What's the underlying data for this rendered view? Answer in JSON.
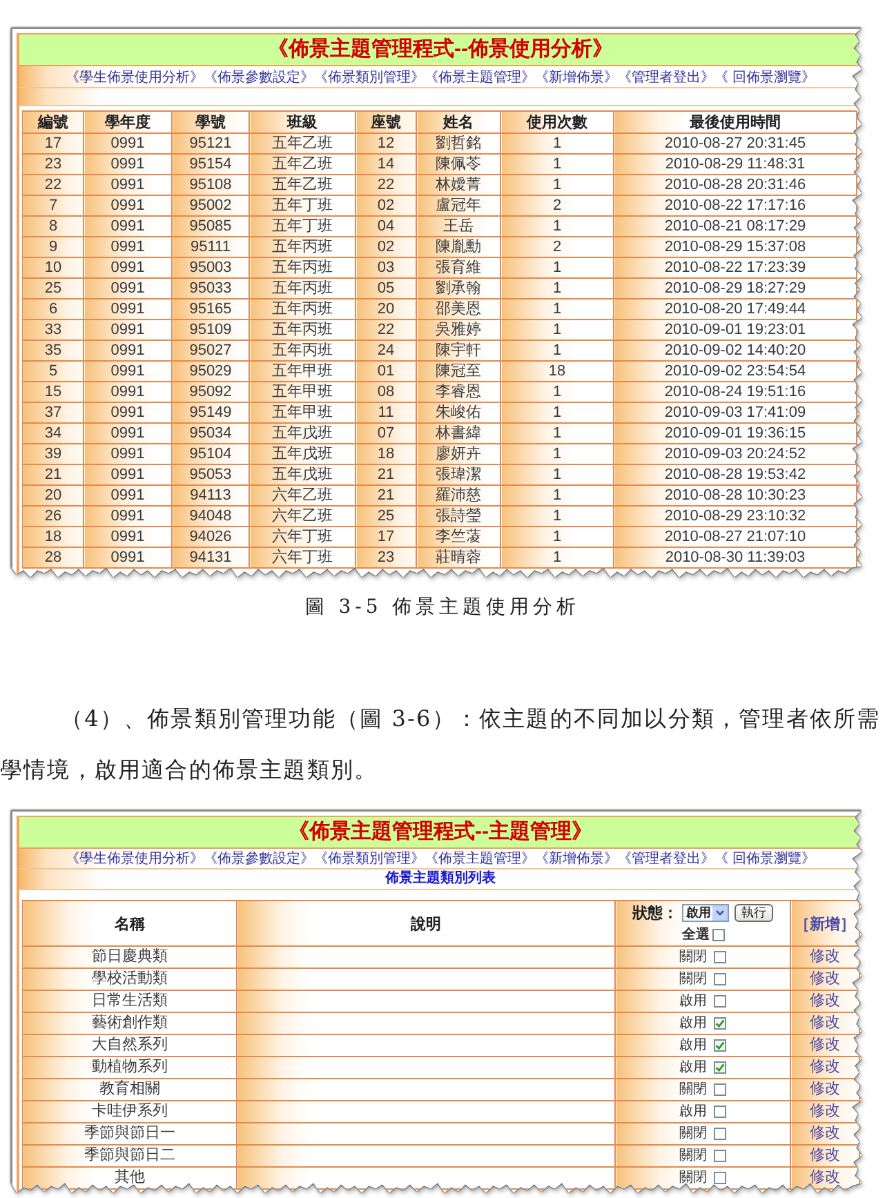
{
  "usage_screenshot": {
    "title": "《佈景主題管理程式--佈景使用分析》",
    "nav_links": [
      "《學生佈景使用分析》",
      "《佈景參數設定》",
      "《佈景類別管理》",
      "《佈景主題管理》",
      "《新增佈景》",
      "《管理者登出》",
      "《 回佈景瀏覽》"
    ],
    "table": {
      "columns": [
        "編號",
        "學年度",
        "學號",
        "班級",
        "座號",
        "姓名",
        "使用次數",
        "最後使用時間"
      ],
      "rows": [
        [
          "17",
          "0991",
          "95121",
          "五年乙班",
          "12",
          "劉哲銘",
          "1",
          "2010-08-27 20:31:45"
        ],
        [
          "23",
          "0991",
          "95154",
          "五年乙班",
          "14",
          "陳佩苓",
          "1",
          "2010-08-29 11:48:31"
        ],
        [
          "22",
          "0991",
          "95108",
          "五年乙班",
          "22",
          "林嬡菁",
          "1",
          "2010-08-28 20:31:46"
        ],
        [
          "7",
          "0991",
          "95002",
          "五年丁班",
          "02",
          "盧冠年",
          "2",
          "2010-08-22 17:17:16"
        ],
        [
          "8",
          "0991",
          "95085",
          "五年丁班",
          "04",
          "王岳",
          "1",
          "2010-08-21 08:17:29"
        ],
        [
          "9",
          "0991",
          "95111",
          "五年丙班",
          "02",
          "陳胤勳",
          "2",
          "2010-08-29 15:37:08"
        ],
        [
          "10",
          "0991",
          "95003",
          "五年丙班",
          "03",
          "張育維",
          "1",
          "2010-08-22 17:23:39"
        ],
        [
          "25",
          "0991",
          "95033",
          "五年丙班",
          "05",
          "劉承翰",
          "1",
          "2010-08-29 18:27:29"
        ],
        [
          "6",
          "0991",
          "95165",
          "五年丙班",
          "20",
          "邵美恩",
          "1",
          "2010-08-20 17:49:44"
        ],
        [
          "33",
          "0991",
          "95109",
          "五年丙班",
          "22",
          "吳雅婷",
          "1",
          "2010-09-01 19:23:01"
        ],
        [
          "35",
          "0991",
          "95027",
          "五年丙班",
          "24",
          "陳宇軒",
          "1",
          "2010-09-02 14:40:20"
        ],
        [
          "5",
          "0991",
          "95029",
          "五年甲班",
          "01",
          "陳冠至",
          "18",
          "2010-09-02 23:54:54"
        ],
        [
          "15",
          "0991",
          "95092",
          "五年甲班",
          "08",
          "李睿恩",
          "1",
          "2010-08-24 19:51:16"
        ],
        [
          "37",
          "0991",
          "95149",
          "五年甲班",
          "11",
          "朱峻佑",
          "1",
          "2010-09-03 17:41:09"
        ],
        [
          "34",
          "0991",
          "95034",
          "五年戊班",
          "07",
          "林書緯",
          "1",
          "2010-09-01 19:36:15"
        ],
        [
          "39",
          "0991",
          "95104",
          "五年戊班",
          "18",
          "廖妍卉",
          "1",
          "2010-09-03 20:24:52"
        ],
        [
          "21",
          "0991",
          "95053",
          "五年戊班",
          "21",
          "張瑋潔",
          "1",
          "2010-08-28 19:53:42"
        ],
        [
          "20",
          "0991",
          "94113",
          "六年乙班",
          "21",
          "羅沛慈",
          "1",
          "2010-08-28 10:30:23"
        ],
        [
          "26",
          "0991",
          "94048",
          "六年乙班",
          "25",
          "張詩瑩",
          "1",
          "2010-08-29 23:10:32"
        ],
        [
          "18",
          "0991",
          "94026",
          "六年丁班",
          "17",
          "李竺蓤",
          "1",
          "2010-08-27 21:07:10"
        ],
        [
          "28",
          "0991",
          "94131",
          "六年丁班",
          "23",
          "莊晴蓉",
          "1",
          "2010-08-30 11:39:03"
        ]
      ]
    }
  },
  "figure_caption": "圖 3-5 佈景主題使用分析",
  "paragraph": {
    "lines": [
      "（4）、佈景類別管理功能（圖 3-6）：依主題的不同加以分類，管理者依所需",
      "學情境，啟用適合的佈景主題類別。"
    ]
  },
  "category_screenshot": {
    "title": "《佈景主題管理程式--主題管理》",
    "nav_links": [
      "《學生佈景使用分析》",
      "《佈景參數設定》",
      "《佈景類別管理》",
      "《佈景主題管理》",
      "《新增佈景》",
      "《管理者登出》",
      "《 回佈景瀏覽》"
    ],
    "list_title": "佈景主題類別列表",
    "columns": [
      "名稱",
      "說明"
    ],
    "status_header": {
      "label": "狀態：",
      "filter_value": "啟用",
      "run_button": "執行",
      "select_all_label": "全選",
      "select_all_checked": false
    },
    "add_link": "［新增］",
    "rows": [
      {
        "name": "節日慶典類",
        "status": "關閉",
        "checked": false,
        "edit_link": "修改"
      },
      {
        "name": "學校活動類",
        "status": "關閉",
        "checked": false,
        "edit_link": "修改"
      },
      {
        "name": "日常生活類",
        "status": "啟用",
        "checked": false,
        "edit_link": "修改"
      },
      {
        "name": "藝術創作類",
        "status": "啟用",
        "checked": true,
        "edit_link": "修改"
      },
      {
        "name": "大自然系列",
        "status": "啟用",
        "checked": true,
        "edit_link": "修改"
      },
      {
        "name": "動植物系列",
        "status": "啟用",
        "checked": true,
        "edit_link": "修改"
      },
      {
        "name": "教育相關",
        "status": "關閉",
        "checked": false,
        "edit_link": "修改"
      },
      {
        "name": "卡哇伊系列",
        "status": "啟用",
        "checked": false,
        "edit_link": "修改"
      },
      {
        "name": "季節與節日一",
        "status": "關閉",
        "checked": false,
        "edit_link": "修改"
      },
      {
        "name": "季節與節日二",
        "status": "關閉",
        "checked": false,
        "edit_link": "修改"
      },
      {
        "name": "其他",
        "status": "關閉",
        "checked": false,
        "edit_link": "修改"
      }
    ]
  }
}
